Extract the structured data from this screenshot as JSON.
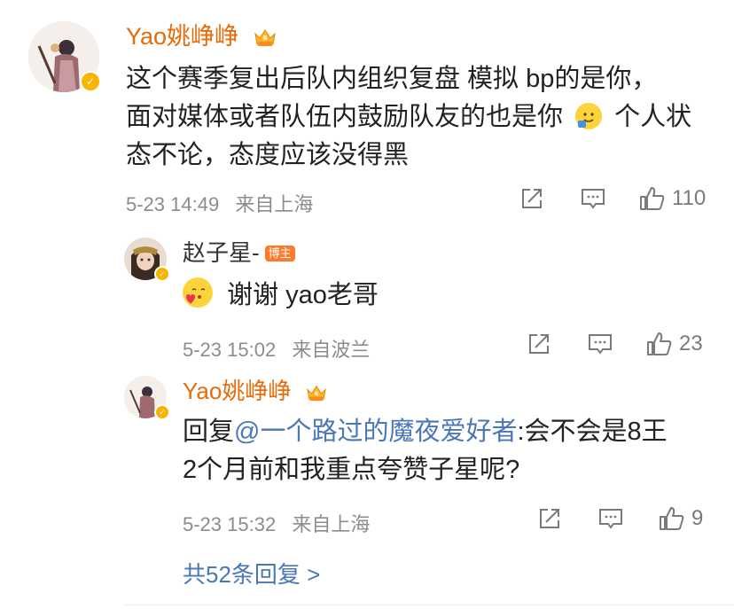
{
  "comment": {
    "user": "Yao姚峥峥",
    "text_line1": "这个赛季复出后队内组织复盘 模拟 bp的是你，",
    "text_line2a": "面对媒体或者队伍内鼓励队友的也是你",
    "text_line2b": "个人状",
    "text_line3": "态不论，态度应该没得黑",
    "date": "5-23 14:49",
    "location": "来自上海",
    "likes": "110"
  },
  "reply1": {
    "user": "赵子星-",
    "badge": "博主",
    "text": "谢谢 yao老哥",
    "date": "5-23 15:02",
    "location": "来自波兰",
    "likes": "23"
  },
  "reply2": {
    "user": "Yao姚峥峥",
    "prefix": "回复",
    "mention": "@一个路过的魔夜爱好者",
    "text_line1": ":会不会是8王",
    "text_line2": "2个月前和我重点夸赞子星呢?",
    "date": "5-23 15:32",
    "location": "来自上海",
    "likes": "9"
  },
  "footer": {
    "more_replies": "共52条回复 >"
  },
  "icons": {
    "verified": "verified-badge-icon",
    "vip": "crown-vip-icon",
    "share": "share-icon",
    "comment": "comment-icon",
    "like": "thumbs-up-icon"
  },
  "colors": {
    "username": "#e86b0a",
    "link": "#4a77b8",
    "meta": "#8c8c8c",
    "verified": "#f7b500"
  }
}
